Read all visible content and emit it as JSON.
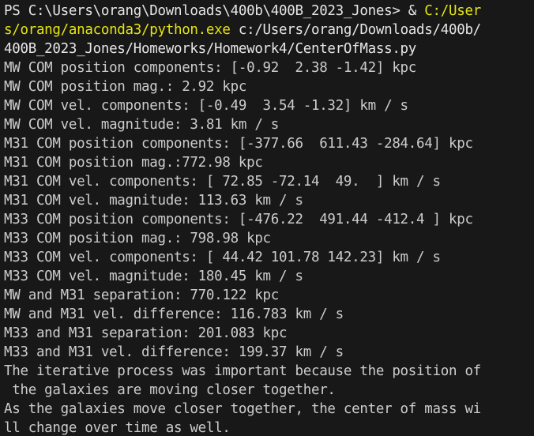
{
  "terminal": {
    "prompt_line1_a": "PS C:\\Users\\orang\\Downloads\\400b\\400B_2023_Jones> & ",
    "prompt_line1_b": "C:/User",
    "prompt_line2_a": "s/orang/anaconda3/python.exe",
    "prompt_line2_b": " c:/Users/orang/Downloads/400b/",
    "prompt_line3": "400B_2023_Jones/Homeworks/Homework4/CenterOfMass.py",
    "output": [
      "MW COM position components: [-0.92  2.38 -1.42] kpc",
      "MW COM position mag.: 2.92 kpc",
      "MW COM vel. components: [-0.49  3.54 -1.32] km / s",
      "MW COM vel. magnitude: 3.81 km / s",
      "M31 COM position components: [-377.66  611.43 -284.64] kpc",
      "M31 COM position mag.:772.98 kpc",
      "M31 COM vel. components: [ 72.85 -72.14  49.  ] km / s",
      "M31 COM vel. magnitude: 113.63 km / s",
      "M33 COM position components: [-476.22  491.44 -412.4 ] kpc",
      "M33 COM position mag.: 798.98 kpc",
      "M33 COM vel. components: [ 44.42 101.78 142.23] km / s",
      "M33 COM vel. magnitude: 180.45 km / s",
      "MW and M31 separation: 770.122 kpc",
      "MW and M31 vel. difference: 116.783 km / s",
      "M33 and M31 separation: 201.083 kpc",
      "M33 and M31 vel. difference: 199.37 km / s",
      "The iterative process was important because the position of",
      " the galaxies are moving closer together.",
      "As the galaxies move closer together, the center of mass wi",
      "ll change over time as well."
    ]
  }
}
